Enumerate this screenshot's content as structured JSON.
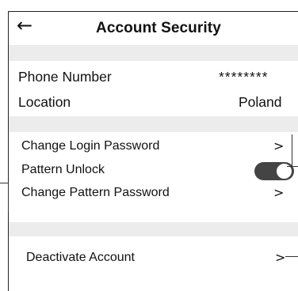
{
  "header": {
    "back_icon": "arrow-left-icon",
    "title": "Account Security"
  },
  "info": {
    "phone_label": "Phone Number",
    "phone_value": "********",
    "location_label": "Location",
    "location_value": "Poland"
  },
  "settings": {
    "change_login_password": "Change Login Password",
    "pattern_unlock": "Pattern Unlock",
    "pattern_unlock_enabled": true,
    "change_pattern_password": "Change Pattern Password",
    "deactivate_account": "Deactivate Account",
    "chevron": ">"
  },
  "colors": {
    "section_gap": "#ececec",
    "toggle_on": "#444444"
  }
}
